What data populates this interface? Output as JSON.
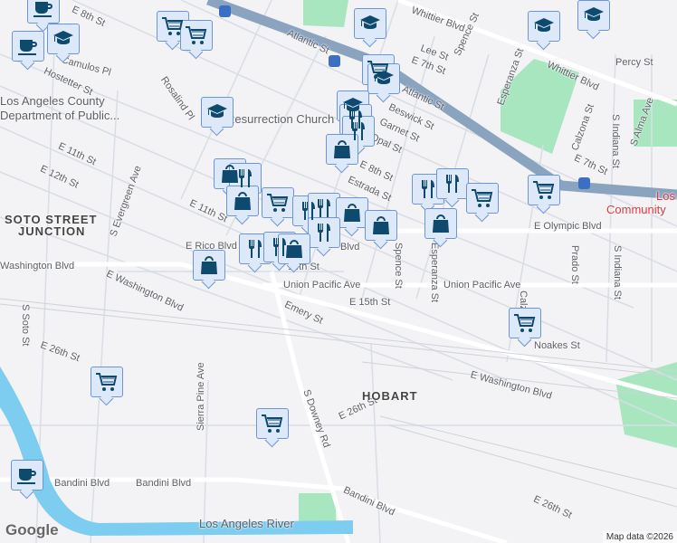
{
  "map": {
    "attribution": "Map data ©2026",
    "logo": "Google",
    "colors": {
      "marker_fill": "#dde8f9",
      "marker_border": "#6c95d6",
      "icon": "#0d4a6e",
      "freeway": "#8aa4c0",
      "park": "#a8e6c0",
      "river": "#7ccdf0"
    },
    "area_labels": {
      "soto1": "SOTO STREET",
      "soto2": "JUNCTION",
      "hobart": "HOBART"
    },
    "poi_labels": {
      "dept1": "Los Angeles County",
      "dept2": "Department of Public...",
      "church": "Resurrection Church",
      "comm": "Los",
      "comm2": "Community",
      "river": "Los Angeles River"
    },
    "street_labels": [
      "E 8th St",
      "Atlantic St",
      "Whittier Blvd",
      "Camulos Pl",
      "Hostetter St",
      "Rosalind Pl",
      "E 11th St",
      "E 12th St",
      "S Evergreen Ave",
      "E 11th St",
      "E Rico Blvd",
      "Washington Blvd",
      "E Washington Blvd",
      "S Soto St",
      "Lee St",
      "E 7th St",
      "Spence St",
      "Atlantic St",
      "Beswick St",
      "Garnet St",
      "Opal St",
      "E 8th St",
      "Estrada St",
      "Esperanza St",
      "Whittier Blvd",
      "Percy St",
      "Calzona St",
      "E 7th St",
      "S Indiana St",
      "S Alma Ave",
      "E Olympic Blvd",
      "Prado St",
      "S Indiana St",
      "Union Pacific Ave",
      "Union Pacific Ave",
      "Emery St",
      "E 15th St",
      "Noakes St",
      "E 26th St",
      "E Washington Blvd",
      "S Downey Rd",
      "E 26th St",
      "Sierra Pine Ave",
      "Bandini Blvd",
      "Bandini Blvd",
      "Bandini Blvd",
      "E 26th St",
      "Spence St",
      "Esperanza St",
      "Blvd",
      "14th St",
      "Calzona St"
    ],
    "markers": [
      "coffee",
      "coffee",
      "school",
      "cart",
      "cart",
      "school",
      "school",
      "cart",
      "school",
      "school",
      "school",
      "school",
      "restaurant",
      "restaurant",
      "shopping",
      "shopping",
      "restaurant",
      "shopping",
      "cart",
      "restaurant",
      "restaurant",
      "shopping",
      "restaurant",
      "shopping",
      "restaurant",
      "restaurant",
      "shopping",
      "shopping",
      "restaurant",
      "restaurant",
      "cart",
      "shopping",
      "cart",
      "cart",
      "cart",
      "cart",
      "coffee"
    ]
  }
}
